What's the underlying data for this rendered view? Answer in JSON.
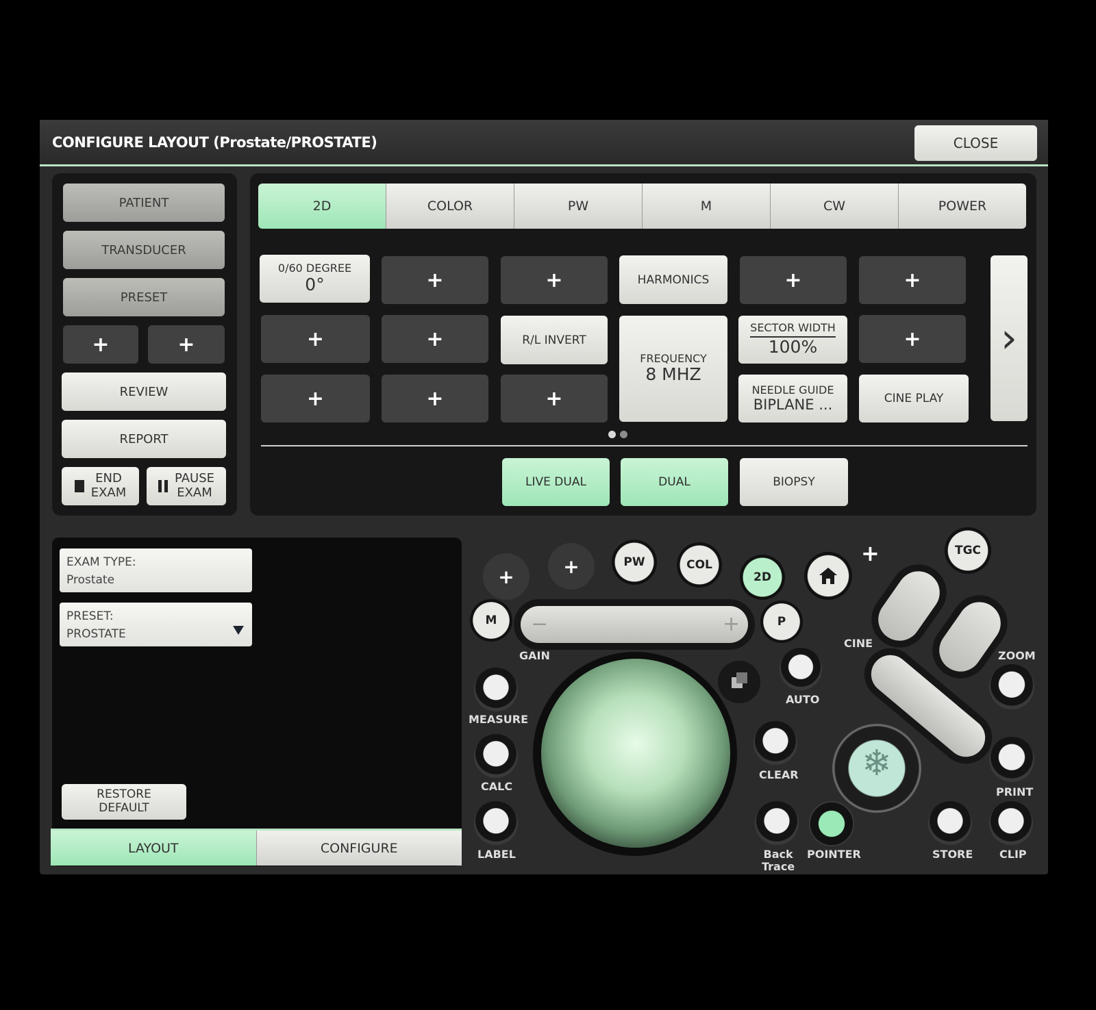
{
  "window": {
    "title": "CONFIGURE LAYOUT (Prostate/PROSTATE)",
    "close_label": "CLOSE"
  },
  "sidebar": {
    "patient": "PATIENT",
    "transducer": "TRANSDUCER",
    "preset": "PRESET",
    "plus": "+",
    "review": "REVIEW",
    "report": "REPORT",
    "end_exam": [
      "END",
      "EXAM"
    ],
    "pause_exam": [
      "PAUSE",
      "EXAM"
    ]
  },
  "mode_tabs": [
    "2D",
    "COLOR",
    "PW",
    "M",
    "CW",
    "POWER"
  ],
  "grid": {
    "plus": "+",
    "degree": {
      "label": "0/60 DEGREE",
      "value": "0°"
    },
    "harmonics": "HARMONICS",
    "rl_invert": "R/L INVERT",
    "frequency": {
      "label": "FREQUENCY",
      "value": "8 MHZ"
    },
    "sector_width": {
      "label": "SECTOR WIDTH",
      "value": "100%"
    },
    "needle_guide": {
      "label": "NEEDLE GUIDE",
      "value": "BIPLANE ..."
    },
    "cine_play": "CINE PLAY",
    "next_arrow": "›"
  },
  "bottom_modes": [
    "LIVE DUAL",
    "DUAL",
    "BIOPSY"
  ],
  "exam": {
    "type_label": "EXAM TYPE:",
    "type_value": "Prostate",
    "preset_label": "PRESET:",
    "preset_value": "PROSTATE"
  },
  "restore_default": [
    "RESTORE",
    "DEFAULT"
  ],
  "bottom_tabs": {
    "layout": "LAYOUT",
    "configure": "CONFIGURE"
  },
  "console": {
    "plus": "+",
    "pw": "PW",
    "col": "COL",
    "two_d": "2D",
    "tgc": "TGC",
    "m": "M",
    "p": "P",
    "gain": "GAIN",
    "minus": "−",
    "cine": "CINE",
    "zoom": "ZOOM",
    "auto": "AUTO",
    "measure": "MEASURE",
    "calc": "CALC",
    "clear": "CLEAR",
    "print": "PRINT",
    "label": "LABEL",
    "back_trace": [
      "Back",
      "Trace"
    ],
    "pointer": "POINTER",
    "store": "STORE",
    "clip": "CLIP"
  },
  "colors": {
    "accent_green": "#a9eabf",
    "panel": "#171717",
    "frame": "#2b2b2b"
  }
}
